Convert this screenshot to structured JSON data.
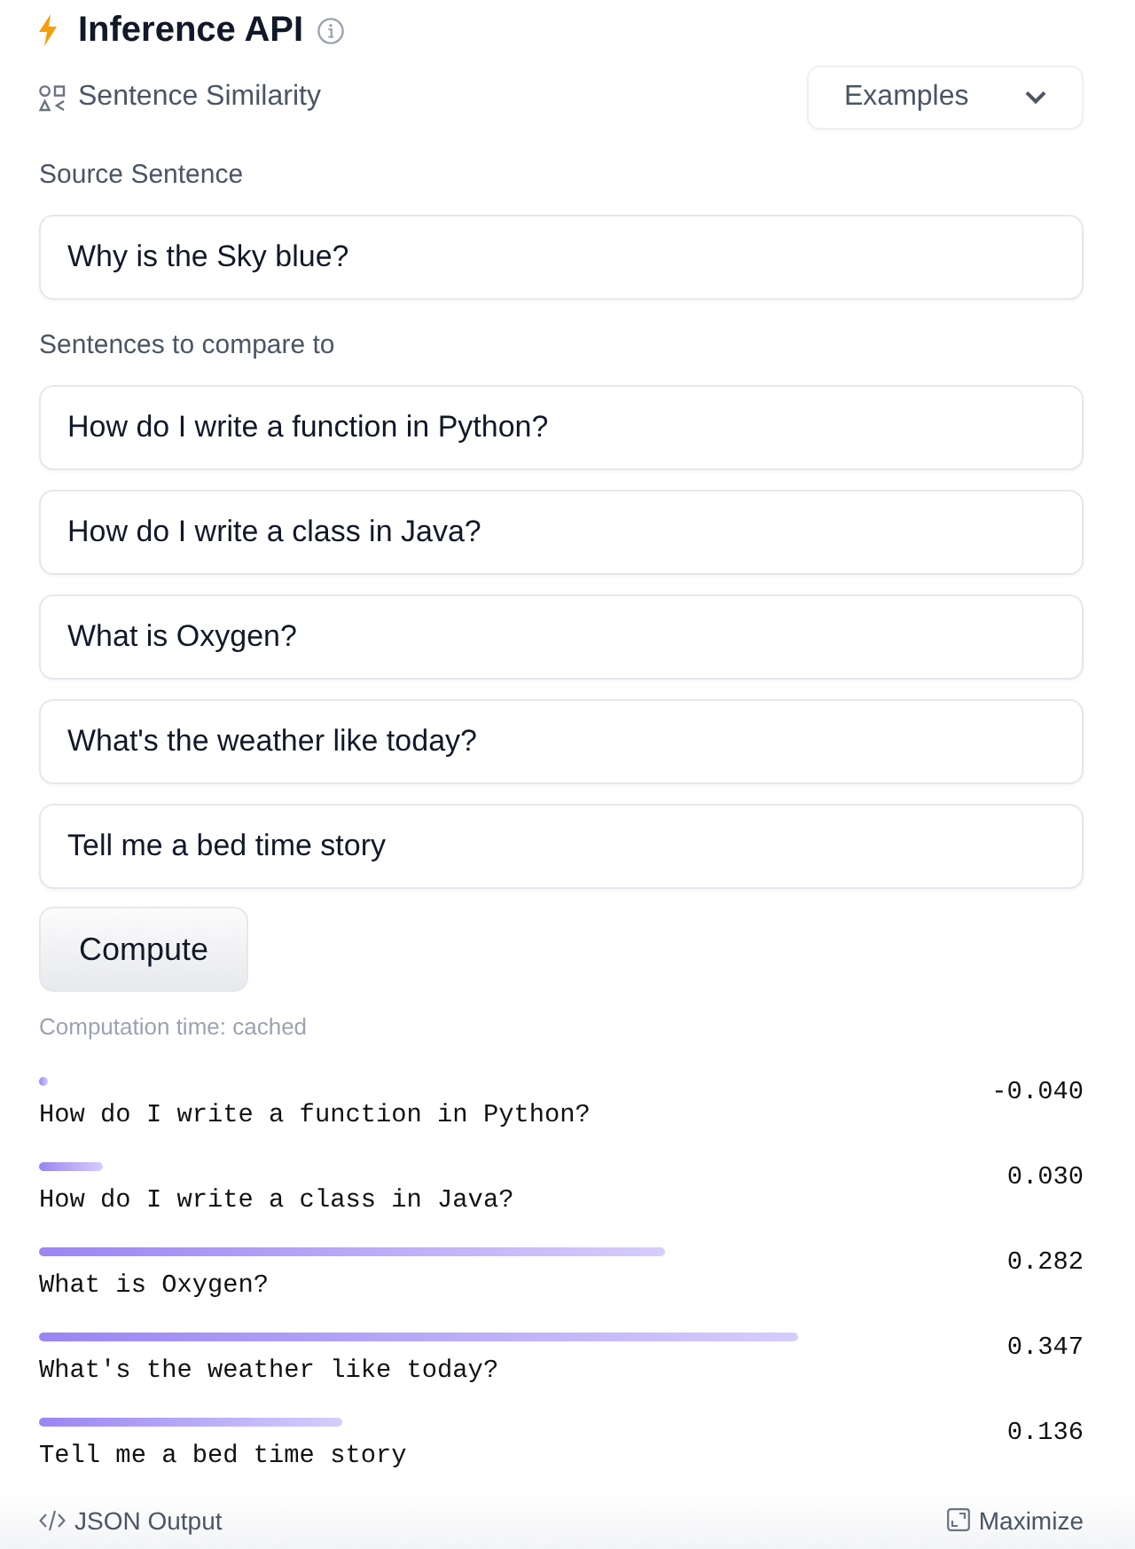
{
  "header": {
    "title": "Inference API"
  },
  "task": {
    "label": "Sentence Similarity"
  },
  "examples_dropdown": {
    "label": "Examples"
  },
  "source": {
    "label": "Source Sentence",
    "value": "Why is the Sky blue?"
  },
  "compare": {
    "label": "Sentences to compare to",
    "sentences": [
      "How do I write a function in Python?",
      "How do I write a class in Java?",
      "What is Oxygen?",
      "What's the weather like today?",
      "Tell me a bed time story"
    ]
  },
  "compute_button": {
    "label": "Compute"
  },
  "computation_time": "Computation time: cached",
  "results": [
    {
      "sentence": "How do I write a function in Python?",
      "score": "-0.040",
      "level": 0.009
    },
    {
      "sentence": "How do I write a class in Java?",
      "score": "0.030",
      "level": 0.061
    },
    {
      "sentence": "What is Oxygen?",
      "score": "0.282",
      "level": 0.6
    },
    {
      "sentence": "What's the weather like today?",
      "score": "0.347",
      "level": 0.727
    },
    {
      "sentence": "Tell me a bed time story",
      "score": "0.136",
      "level": 0.29
    }
  ],
  "footer": {
    "json_output": "JSON Output",
    "maximize": "Maximize"
  }
}
